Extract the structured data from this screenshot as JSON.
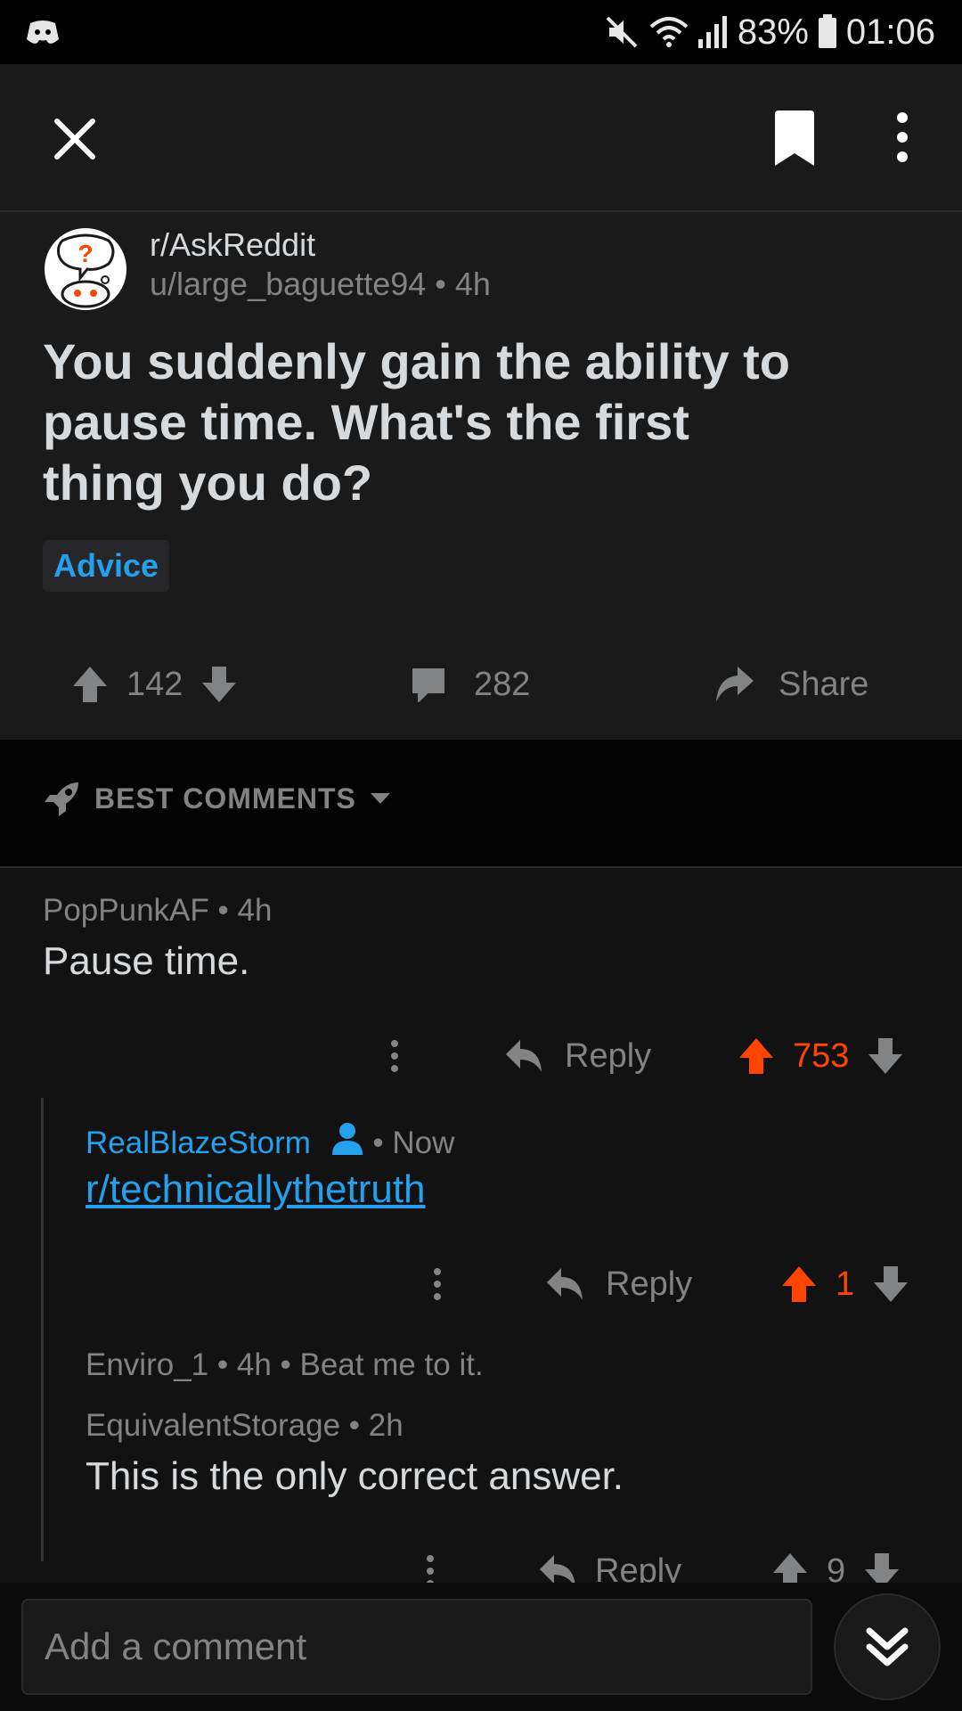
{
  "status_bar": {
    "battery": "83%",
    "time": "01:06",
    "icons": [
      "discord-icon",
      "mute-icon",
      "wifi-icon",
      "signal-icon",
      "battery-icon"
    ]
  },
  "toolbar": {
    "icons": [
      "close-icon",
      "bookmark-icon",
      "more-vertical-icon"
    ]
  },
  "post": {
    "subreddit": "r/AskReddit",
    "author": "u/large_baguette94",
    "age": "• 4h",
    "title": "You suddenly gain the ability to pause time. What's the first thing you do?",
    "flair": "Advice",
    "score": "142",
    "comment_count": "282",
    "share_label": "Share"
  },
  "sort": {
    "label": "BEST COMMENTS"
  },
  "comments": [
    {
      "author": "PopPunkAF",
      "age": "• 4h",
      "body": "Pause time.",
      "reply_label": "Reply",
      "score": "753"
    },
    {
      "author": "RealBlazeStorm",
      "age": "• Now",
      "body": "r/technicallythetruth",
      "reply_label": "Reply",
      "score": "1"
    },
    {
      "collapsed_author": "Enviro_1",
      "collapsed_meta": "• 4h • Beat me to it."
    },
    {
      "author": "EquivalentStorage",
      "age": "• 2h",
      "body": "This is the only correct answer.",
      "reply_label": "Reply",
      "score": "9"
    }
  ],
  "composer": {
    "placeholder": "Add a comment"
  },
  "colors": {
    "upvote": "#ff4500",
    "link": "#24a0ed",
    "muted": "#818384",
    "text": "#d7dadc"
  }
}
